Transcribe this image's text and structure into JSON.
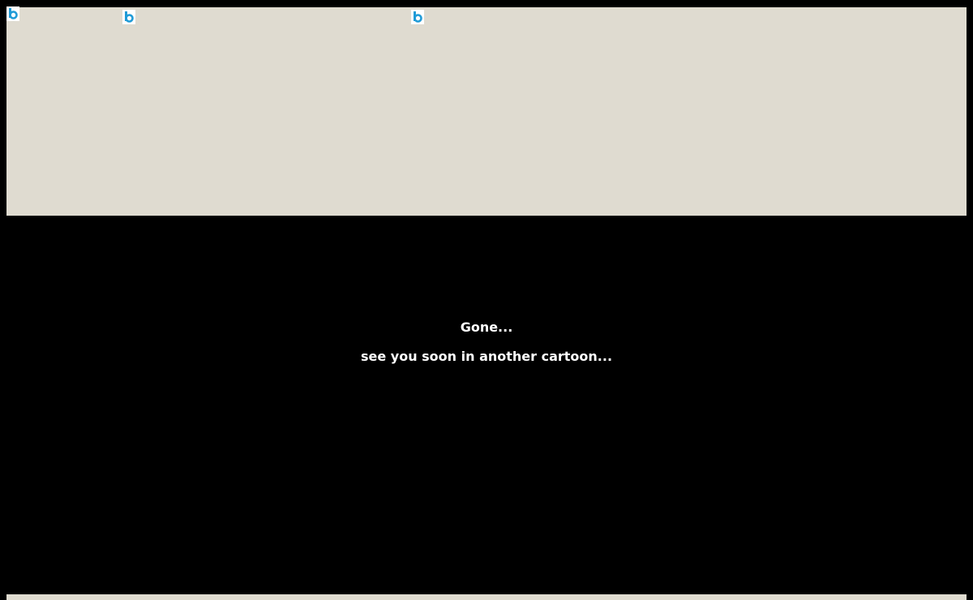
{
  "colors": {
    "page_background": "#000000",
    "banner_background": "#dfdbd0",
    "text": "#ffffff",
    "icon_accent": "#1f9bd7"
  },
  "header": {
    "images": [
      {
        "icon": "broken-image-icon"
      },
      {
        "icon": "broken-image-icon"
      },
      {
        "icon": "broken-image-icon"
      }
    ]
  },
  "message": {
    "line1": "Gone...",
    "line2": "see you soon in another cartoon..."
  }
}
